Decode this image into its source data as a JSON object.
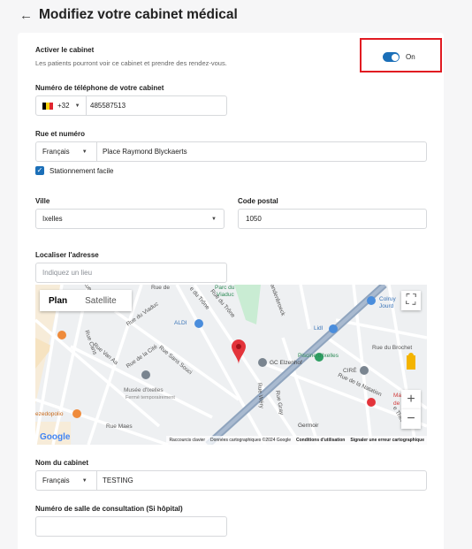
{
  "header": {
    "back_icon": "arrow-left-icon",
    "title": "Modifiez votre cabinet médical"
  },
  "activation": {
    "label": "Activer le cabinet",
    "help": "Les patients pourront voir ce cabinet et prendre des rendez-vous.",
    "toggle_state": "On",
    "accent": "#1b6fb8",
    "highlight": "#e11b22"
  },
  "phone": {
    "label": "Numéro de téléphone de votre cabinet",
    "country_code": "+32",
    "number": "485587513"
  },
  "street": {
    "label": "Rue et numéro",
    "language": "Français",
    "value": "Place Raymond Blyckaerts"
  },
  "parking": {
    "label": "Stationnement facile",
    "checked": true
  },
  "city": {
    "label": "Ville",
    "value": "Ixelles"
  },
  "postal": {
    "label": "Code postal",
    "value": "1050"
  },
  "locate": {
    "label": "Localiser l'adresse",
    "placeholder": "Indiquez un lieu"
  },
  "map": {
    "tab_plan": "Plan",
    "tab_satellite": "Satellite",
    "google": "Google",
    "footer": {
      "shortcuts": "Raccourcis clavier",
      "data": "Données cartographiques ©2024 Google",
      "terms": "Conditions d'utilisation",
      "report": "Signaler une erreur cartographique"
    },
    "labels": {
      "parc": "Parc du",
      "parc2": "Viaduc",
      "aldi": "ALDI",
      "lidl": "Lidl",
      "piscine": "Piscine d'Ixelles",
      "gc": "GC Elzenhof",
      "cire": "CIRÉ",
      "musee": "Musée d'Ixelles",
      "ferme": "Fermé temporairement",
      "maison": "Maison M",
      "maison2": "de M",
      "germoir": "Germoir",
      "colruyt": "Colruy",
      "colruyt2": "Jourd",
      "ezedopolio": "ezedopolio",
      "rue_viaduc": "Rue du Viaduc",
      "rue_trone": "Rue du Trône",
      "rue_trone2": "e du Trône",
      "rue_cite": "Rue de la Cité",
      "rue_sans_souci": "Rue Sans Souci",
      "rue_van_aa": "Rue Van Aa",
      "rue_maes": "Rue Maes",
      "rue_brochet": "Rue du Brochet",
      "rue_natation": "Rue de la Natation",
      "rue_wery": "Rue Wéry",
      "rue_gray": "Rue Gray",
      "rue_cans": "Rue Cans",
      "rue_ixelles": "Rue d'Ixelles",
      "theux": "e Theux",
      "rue_de": "Rue de",
      "vanderbroeck": "andenbroeck"
    }
  },
  "name": {
    "label": "Nom du cabinet",
    "language": "Français",
    "value": "TESTING"
  },
  "room": {
    "label": "Numéro de salle de consultation (Si hôpital)",
    "value": ""
  }
}
